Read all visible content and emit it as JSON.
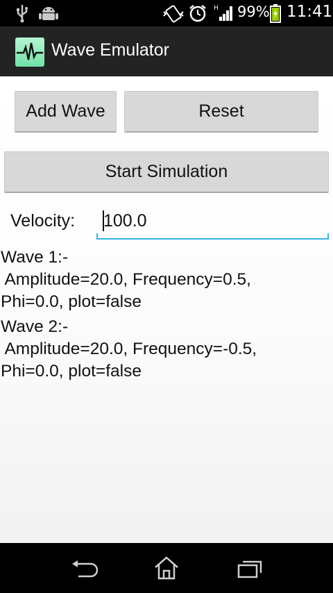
{
  "status_bar": {
    "battery_percent": "99%",
    "time": "11:41",
    "icons": [
      "usb-icon",
      "android-debug-icon",
      "vibrate-icon",
      "alarm-icon",
      "signal-icon",
      "battery-charging-icon"
    ]
  },
  "app_bar": {
    "title": "Wave Emulator",
    "icon": "waveform-app-icon"
  },
  "controls": {
    "add_wave_label": "Add Wave",
    "reset_label": "Reset",
    "start_label": "Start Simulation",
    "velocity_label": "Velocity:",
    "velocity_value": "100.0"
  },
  "waves": [
    {
      "header": "Wave 1:-",
      "line1": " Amplitude=20.0, Frequency=0.5,",
      "line2": "Phi=0.0, plot=false"
    },
    {
      "header": "Wave 2:-",
      "line1": " Amplitude=20.0, Frequency=-0.5,",
      "line2": "Phi=0.0, plot=false"
    }
  ],
  "nav_bar": {
    "buttons": [
      "back-icon",
      "home-icon",
      "recent-apps-icon"
    ]
  }
}
